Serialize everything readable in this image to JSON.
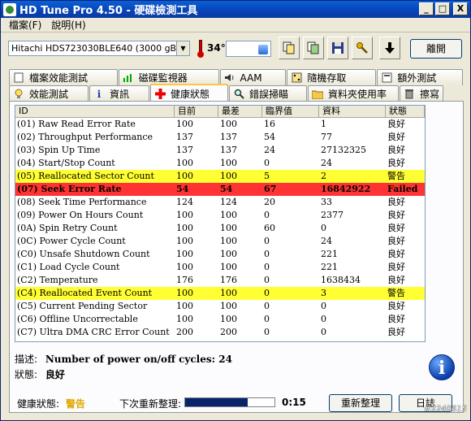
{
  "window": {
    "title": "HD Tune Pro 4.50 - 硬碟檢測工具",
    "min": "_",
    "max": "□",
    "close": "X"
  },
  "menu": [
    "檔案(F)",
    "說明(H)"
  ],
  "toolbar": {
    "drive": "Hitachi HDS723030BLE640  (3000 gB)",
    "temperature": "34℃",
    "exit_label": "離開"
  },
  "tabs_row1": [
    {
      "label": "檔案效能測試",
      "icon": "file-icon"
    },
    {
      "label": "磁碟監視器",
      "icon": "chart-icon"
    },
    {
      "label": "AAM",
      "icon": "speaker-icon"
    },
    {
      "label": "隨機存取",
      "icon": "dice-icon"
    },
    {
      "label": "額外測試",
      "icon": "gear-icon"
    }
  ],
  "tabs_row2": [
    {
      "label": "效能測試",
      "icon": "bulb-icon"
    },
    {
      "label": "資訊",
      "icon": "info-icon"
    },
    {
      "label": "健康狀態",
      "icon": "cross-icon",
      "active": true
    },
    {
      "label": "錯誤掃瞄",
      "icon": "magnifier-icon"
    },
    {
      "label": "資料夾使用率",
      "icon": "folder-icon"
    },
    {
      "label": "擦寫",
      "icon": "trash-icon"
    }
  ],
  "table": {
    "headers": [
      "ID",
      "目前",
      "最差",
      "臨界值",
      "資料",
      "狀態"
    ],
    "rows": [
      {
        "id": "(01) Raw Read Error Rate",
        "cur": "100",
        "worst": "100",
        "thr": "16",
        "data": "1",
        "status": "良好",
        "level": "ok"
      },
      {
        "id": "(02) Throughput Performance",
        "cur": "137",
        "worst": "137",
        "thr": "54",
        "data": "77",
        "status": "良好",
        "level": "ok"
      },
      {
        "id": "(03) Spin Up Time",
        "cur": "137",
        "worst": "137",
        "thr": "24",
        "data": "27132325",
        "status": "良好",
        "level": "ok"
      },
      {
        "id": "(04) Start/Stop Count",
        "cur": "100",
        "worst": "100",
        "thr": "0",
        "data": "24",
        "status": "良好",
        "level": "ok"
      },
      {
        "id": "(05) Reallocated Sector Count",
        "cur": "100",
        "worst": "100",
        "thr": "5",
        "data": "2",
        "status": "警告",
        "level": "warn"
      },
      {
        "id": "(07) Seek Error Rate",
        "cur": "54",
        "worst": "54",
        "thr": "67",
        "data": "16842922",
        "status": "Failed",
        "level": "fail"
      },
      {
        "id": "(08) Seek Time Performance",
        "cur": "124",
        "worst": "124",
        "thr": "20",
        "data": "33",
        "status": "良好",
        "level": "ok"
      },
      {
        "id": "(09) Power On Hours Count",
        "cur": "100",
        "worst": "100",
        "thr": "0",
        "data": "2377",
        "status": "良好",
        "level": "ok"
      },
      {
        "id": "(0A) Spin Retry Count",
        "cur": "100",
        "worst": "100",
        "thr": "60",
        "data": "0",
        "status": "良好",
        "level": "ok"
      },
      {
        "id": "(0C) Power Cycle Count",
        "cur": "100",
        "worst": "100",
        "thr": "0",
        "data": "24",
        "status": "良好",
        "level": "ok"
      },
      {
        "id": "(C0) Unsafe Shutdown Count",
        "cur": "100",
        "worst": "100",
        "thr": "0",
        "data": "221",
        "status": "良好",
        "level": "ok"
      },
      {
        "id": "(C1) Load Cycle Count",
        "cur": "100",
        "worst": "100",
        "thr": "0",
        "data": "221",
        "status": "良好",
        "level": "ok"
      },
      {
        "id": "(C2) Temperature",
        "cur": "176",
        "worst": "176",
        "thr": "0",
        "data": "1638434",
        "status": "良好",
        "level": "ok"
      },
      {
        "id": "(C4) Reallocated Event Count",
        "cur": "100",
        "worst": "100",
        "thr": "0",
        "data": "3",
        "status": "警告",
        "level": "warn"
      },
      {
        "id": "(C5) Current Pending Sector",
        "cur": "100",
        "worst": "100",
        "thr": "0",
        "data": "0",
        "status": "良好",
        "level": "ok"
      },
      {
        "id": "(C6) Offline Uncorrectable",
        "cur": "100",
        "worst": "100",
        "thr": "0",
        "data": "0",
        "status": "良好",
        "level": "ok"
      },
      {
        "id": "(C7) Ultra DMA CRC Error Count",
        "cur": "200",
        "worst": "200",
        "thr": "0",
        "data": "0",
        "status": "良好",
        "level": "ok"
      }
    ]
  },
  "description": {
    "desc_label": "描述:",
    "desc_value": "Number of power on/off cycles: 24",
    "state_label": "狀態:",
    "state_value": "良好"
  },
  "bottom": {
    "health_label": "健康狀態:",
    "health_value": "警告",
    "refresh_label": "下次重新整理:",
    "progress": 0.7,
    "countdown": "0:15",
    "refresh_button": "重新整理",
    "log_button": "日誌",
    "watermark": "#2240615"
  },
  "colors": {
    "warn": "#ffff33",
    "fail": "#ff3333",
    "health": "#e0a800"
  }
}
